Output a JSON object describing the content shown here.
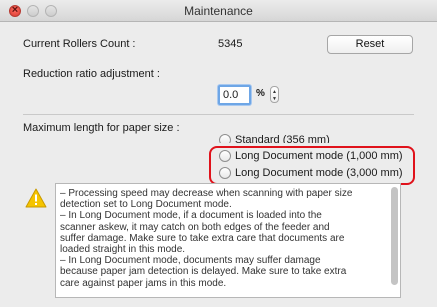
{
  "window": {
    "title": "Maintenance"
  },
  "rollers": {
    "label": "Current Rollers Count :",
    "value": "5345",
    "reset_label": "Reset"
  },
  "reduction": {
    "label": "Reduction ratio adjustment :",
    "value": "0.0",
    "unit": "%"
  },
  "paper_size": {
    "label": "Maximum length for paper size :",
    "options": [
      {
        "label": "Standard (356 mm)",
        "selected": false
      },
      {
        "label": "Long Document mode (1,000 mm)",
        "selected": false
      },
      {
        "label": "Long Document mode (3,000 mm)",
        "selected": false
      }
    ]
  },
  "notice": {
    "icon": "warning-icon",
    "lines": [
      "– Processing speed may decrease when scanning with paper size",
      "detection set to Long Document mode.",
      "– In Long Document mode, if a document is loaded into the",
      "scanner askew, it may catch on both edges of the feeder and",
      "suffer damage. Make sure to take extra care that documents are",
      "loaded straight in this mode.",
      "– In Long Document mode, documents may suffer damage",
      "because paper jam detection is delayed. Make sure to take extra",
      "care against paper jams in this mode."
    ]
  },
  "colors": {
    "highlight": "#e0121b",
    "focus_ring": "#6ea6e6",
    "warning": "#f5c400"
  }
}
